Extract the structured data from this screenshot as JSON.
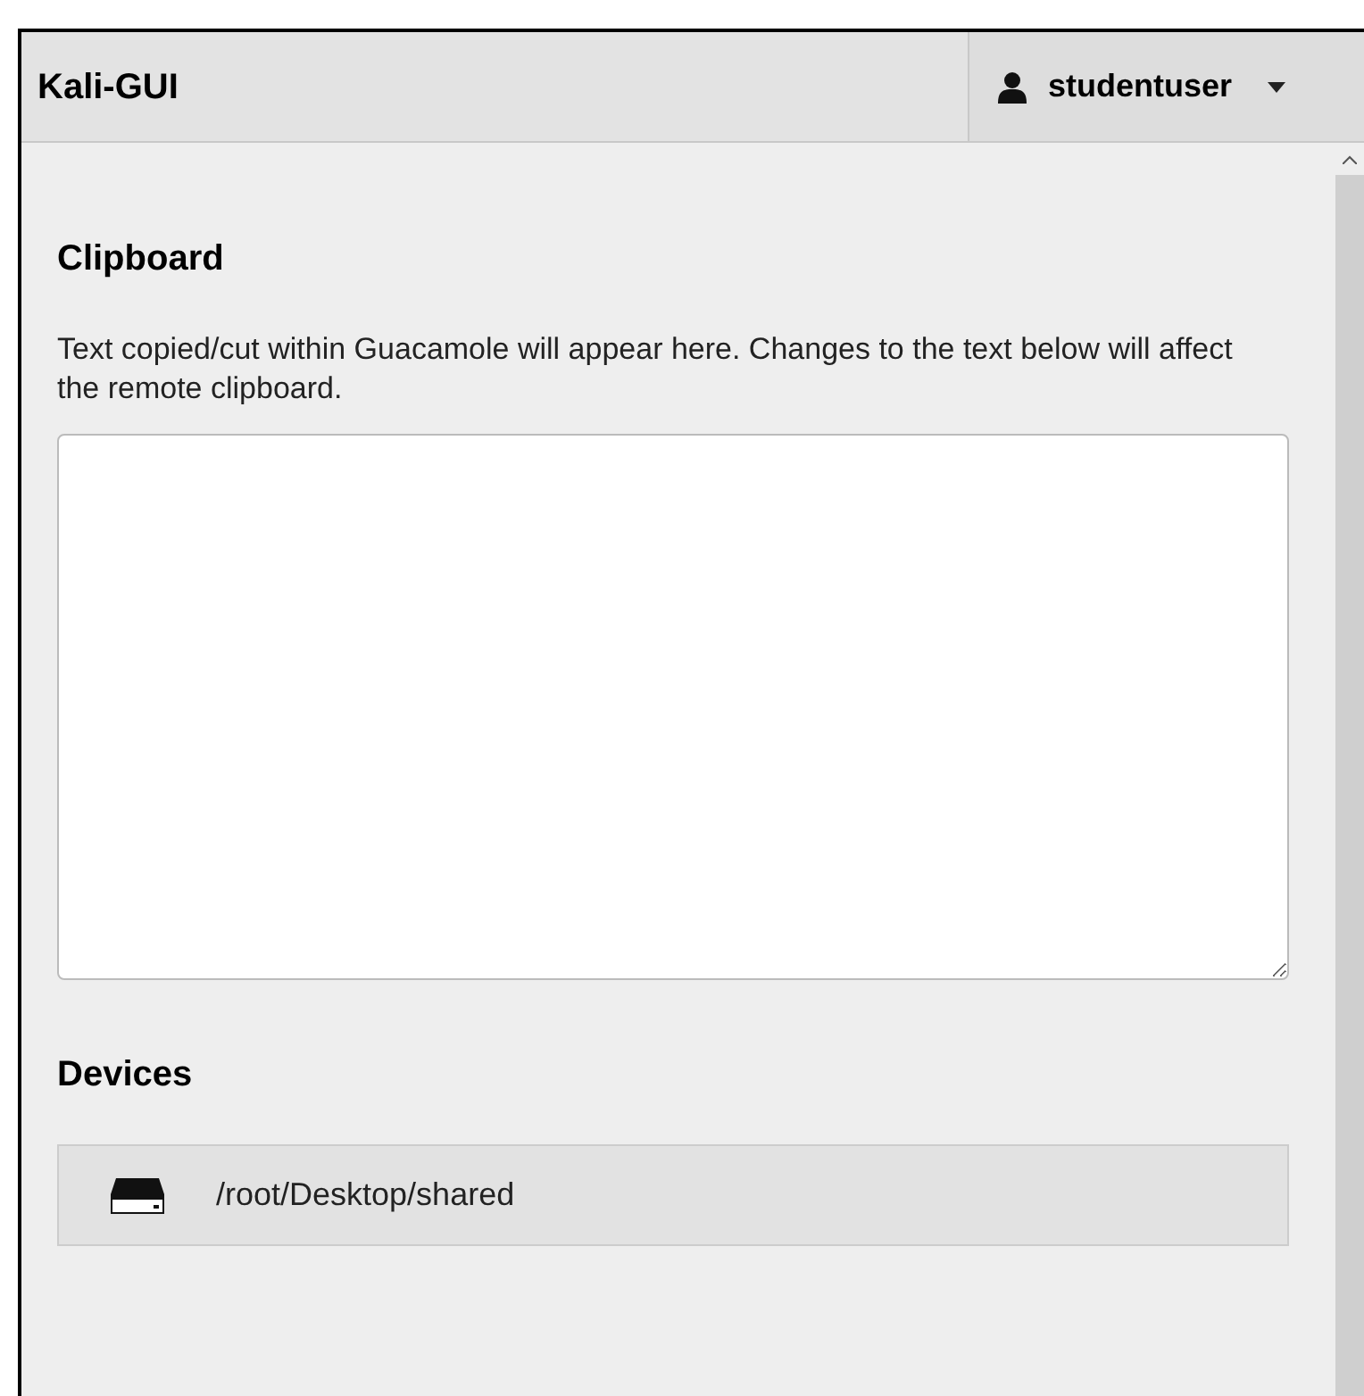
{
  "header": {
    "title": "Kali-GUI",
    "user": "studentuser"
  },
  "clipboard": {
    "heading": "Clipboard",
    "description": "Text copied/cut within Guacamole will appear here. Changes to the text below will affect the remote clipboard."
  },
  "devices": {
    "heading": "Devices",
    "items": [
      {
        "path": "/root/Desktop/shared"
      }
    ]
  }
}
